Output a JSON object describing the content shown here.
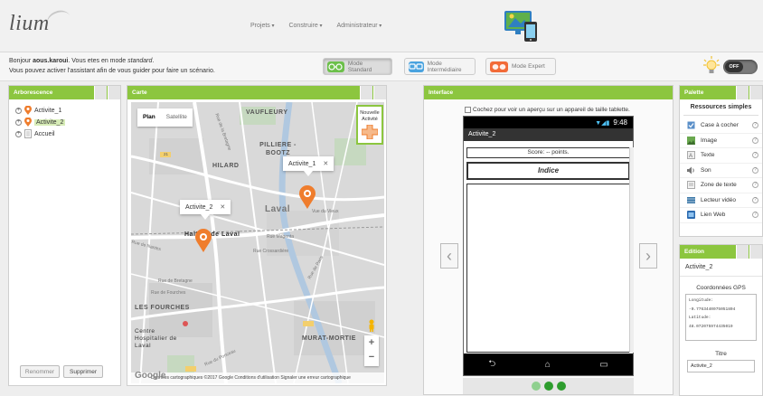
{
  "header": {
    "logo": "lium",
    "menu": [
      "Projets",
      "Construire",
      "Administrateur"
    ]
  },
  "subbar": {
    "greeting_prefix": "Bonjour ",
    "username": "aous.karoui",
    "greeting_mid": ". Vous etes en mode ",
    "mode_name": "standard",
    "greeting_end": ".",
    "assistant_text": "Vous pouvez activer l'assistant afin de vous guider pour faire un scénario.",
    "modes": [
      {
        "label": "Mode Standard",
        "color": "#6cc04a"
      },
      {
        "label": "Mode Intermédiaire",
        "color": "#4aa3df"
      },
      {
        "label": "Mode Expert",
        "color": "#f26b38"
      }
    ],
    "toggle_label": "OFF"
  },
  "arborescence": {
    "title": "Arborescence",
    "items": [
      {
        "label": "Activite_1"
      },
      {
        "label": "Activite_2"
      },
      {
        "label": "Accueil"
      }
    ],
    "rename_button": "Renommer",
    "delete_button": "Supprimer"
  },
  "carte": {
    "title": "Carte",
    "map_types": {
      "plan": "Plan",
      "satellite": "Satellite"
    },
    "new_activity": "Nouvelle Activité",
    "labels": {
      "vaufleury": "VAUFLEURY",
      "pilliere": "PILLIERE - BOOTZ",
      "hilard": "HILARD",
      "laval": "Laval",
      "fourches": "LES FOURCHES",
      "murat": "MURAT-MORTIE",
      "hospital": "Centre Hospitalier de Laval",
      "halte": "Halte... de Laval"
    },
    "street_labels": {
      "magenta": "Rue Magenta",
      "crossardiere": "Rue Crossardière",
      "bretagne": "Rue de Bretagne",
      "puits": "Rue du Ponceau",
      "bd_rue": "Rue de la Bretagne",
      "fourches": "Rue de Fourches",
      "paris": "Rue de Paris",
      "vieux": "Vue du Vieux",
      "nantes": "Rue de Nantes"
    },
    "info_windows": [
      {
        "label": "Activite_1"
      },
      {
        "label": "Activite_2"
      }
    ],
    "road_badges": [
      "21"
    ],
    "footer": "Données cartographiques ©2017 Google   Conditions d'utilisation   Signaler une erreur cartographique",
    "google": "Google"
  },
  "interface": {
    "title": "Interface",
    "tablet_check": "Cochez pour voir un aperçu sur un appareil de taille tablette.",
    "phone_time": "9:48",
    "phone_title": "Activite_2",
    "score": "Score:  --  points.",
    "indice": "Indice"
  },
  "palette": {
    "title": "Palette",
    "section": "Ressources simples",
    "items": [
      {
        "label": "Case à cocher",
        "icon": "checkbox-icon",
        "color": "#5a8fc8"
      },
      {
        "label": "Image",
        "icon": "image-icon",
        "color": "#6aa84f"
      },
      {
        "label": "Texte",
        "icon": "text-icon",
        "color": "#999999"
      },
      {
        "label": "Son",
        "icon": "sound-icon",
        "color": "#777777"
      },
      {
        "label": "Zone de texte",
        "icon": "textarea-icon",
        "color": "#aaaaaa"
      },
      {
        "label": "Lecteur vidéo",
        "icon": "video-icon",
        "color": "#3c78a8"
      },
      {
        "label": "Lien Web",
        "icon": "web-link-icon",
        "color": "#2c6bb0"
      }
    ]
  },
  "edition": {
    "title": "Edition",
    "name": "Activite_2",
    "gps_title": "Coordonnées GPS",
    "longitude_label": "Longitude:",
    "longitude": "-0.7763440075051804",
    "latitude_label": "Latitude:",
    "latitude": "48.072075974435019",
    "titre_label": "Titre",
    "titre_value": "Activite_2"
  },
  "colors": {
    "accent_green": "#8cc63f",
    "marker_orange": "#ef7d2d"
  }
}
